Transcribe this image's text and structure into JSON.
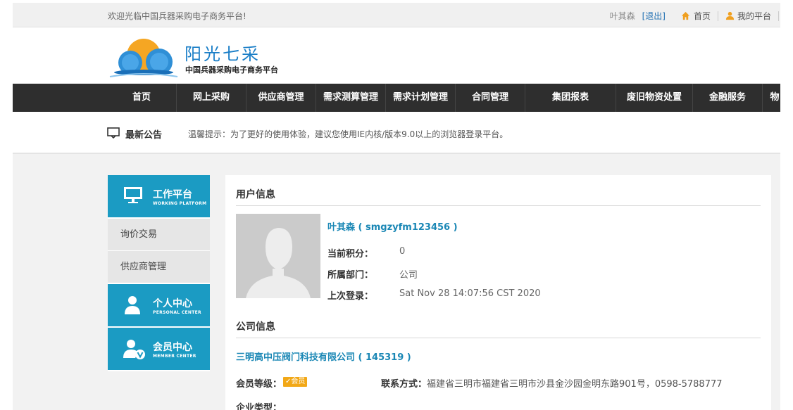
{
  "topbar": {
    "welcome": "欢迎光临中国兵器采购电子商务平台!",
    "username": "叶其森",
    "logout": "[退出]",
    "home": "首页",
    "my_platform": "我的平台"
  },
  "logo": {
    "brand": "阳光七采",
    "subtitle": "中国兵器采购电子商务平台"
  },
  "nav": {
    "items": [
      "首页",
      "网上采购",
      "供应商管理",
      "需求测算管理",
      "需求计划管理",
      "合同管理",
      "集团报表",
      "废旧物资处置",
      "金融服务",
      "物"
    ]
  },
  "notice": {
    "title": "最新公告",
    "text": "温馨提示：为了更好的使用体验，建议您使用IE内核/版本9.0以上的浏览器登录平台。"
  },
  "sidebar": {
    "work": {
      "cn": "工作平台",
      "en": "WORKING PLATFORM"
    },
    "items": [
      "询价交易",
      "供应商管理"
    ],
    "personal": {
      "cn": "个人中心",
      "en": "PERSONAL CENTER"
    },
    "member": {
      "cn": "会员中心",
      "en": "MEMBER CENTER"
    }
  },
  "user_info": {
    "section_title": "用户信息",
    "name_line": "叶其森 ( smgzyfm123456 )",
    "points_label": "当前积分：",
    "points": "0",
    "dept_label": "所属部门：",
    "dept": "公司",
    "last_login_label": "上次登录：",
    "last_login": "Sat Nov 28 14:07:56 CST 2020"
  },
  "company_info": {
    "section_title": "公司信息",
    "company_line": "三明高中压阀门科技有限公司 ( 145319 )",
    "level_label": "会员等级：",
    "level_badge": "会员",
    "contact_label": "联系方式：",
    "contact": "福建省三明市福建省三明市沙县金沙园金明东路901号，0598-5788777",
    "type_label": "企业类型："
  },
  "colors": {
    "accent": "#1b9bc3",
    "nav_bg": "#2e2e2e",
    "link": "#1a87b5",
    "badge": "#f2a817"
  }
}
